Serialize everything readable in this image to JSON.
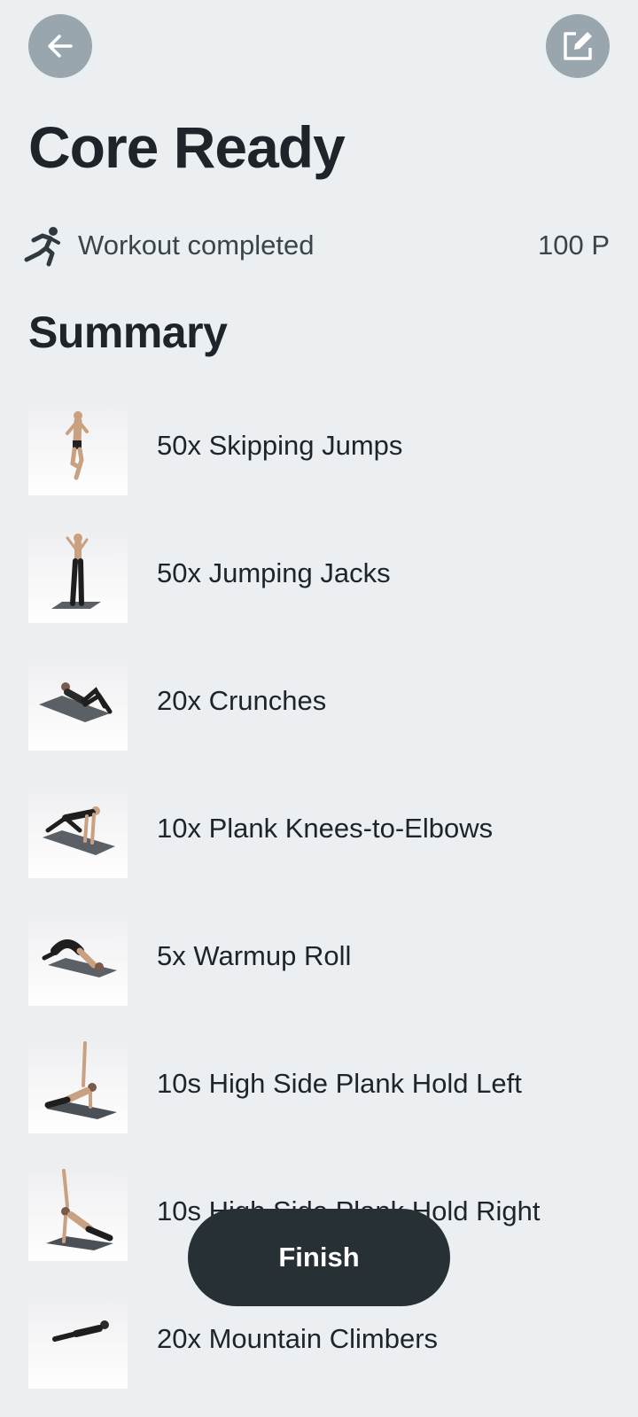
{
  "header": {
    "back_icon": "arrow-left-icon",
    "edit_icon": "edit-icon"
  },
  "workout": {
    "title": "Core Ready",
    "status_icon": "running-person-icon",
    "status": "Workout completed",
    "points": "100 P"
  },
  "summary": {
    "heading": "Summary",
    "items": [
      {
        "label": "50x Skipping Jumps"
      },
      {
        "label": "50x Jumping Jacks"
      },
      {
        "label": "20x Crunches"
      },
      {
        "label": "10x Plank Knees-to-Elbows"
      },
      {
        "label": "5x Warmup Roll"
      },
      {
        "label": "10s High Side Plank Hold Left"
      },
      {
        "label": "10s High Side Plank Hold Right"
      },
      {
        "label": "20x Mountain Climbers"
      }
    ]
  },
  "footer": {
    "finish_label": "Finish"
  },
  "colors": {
    "background": "#ECEFF2",
    "button": "#263035",
    "icon_circle": "#9AA6AD"
  }
}
